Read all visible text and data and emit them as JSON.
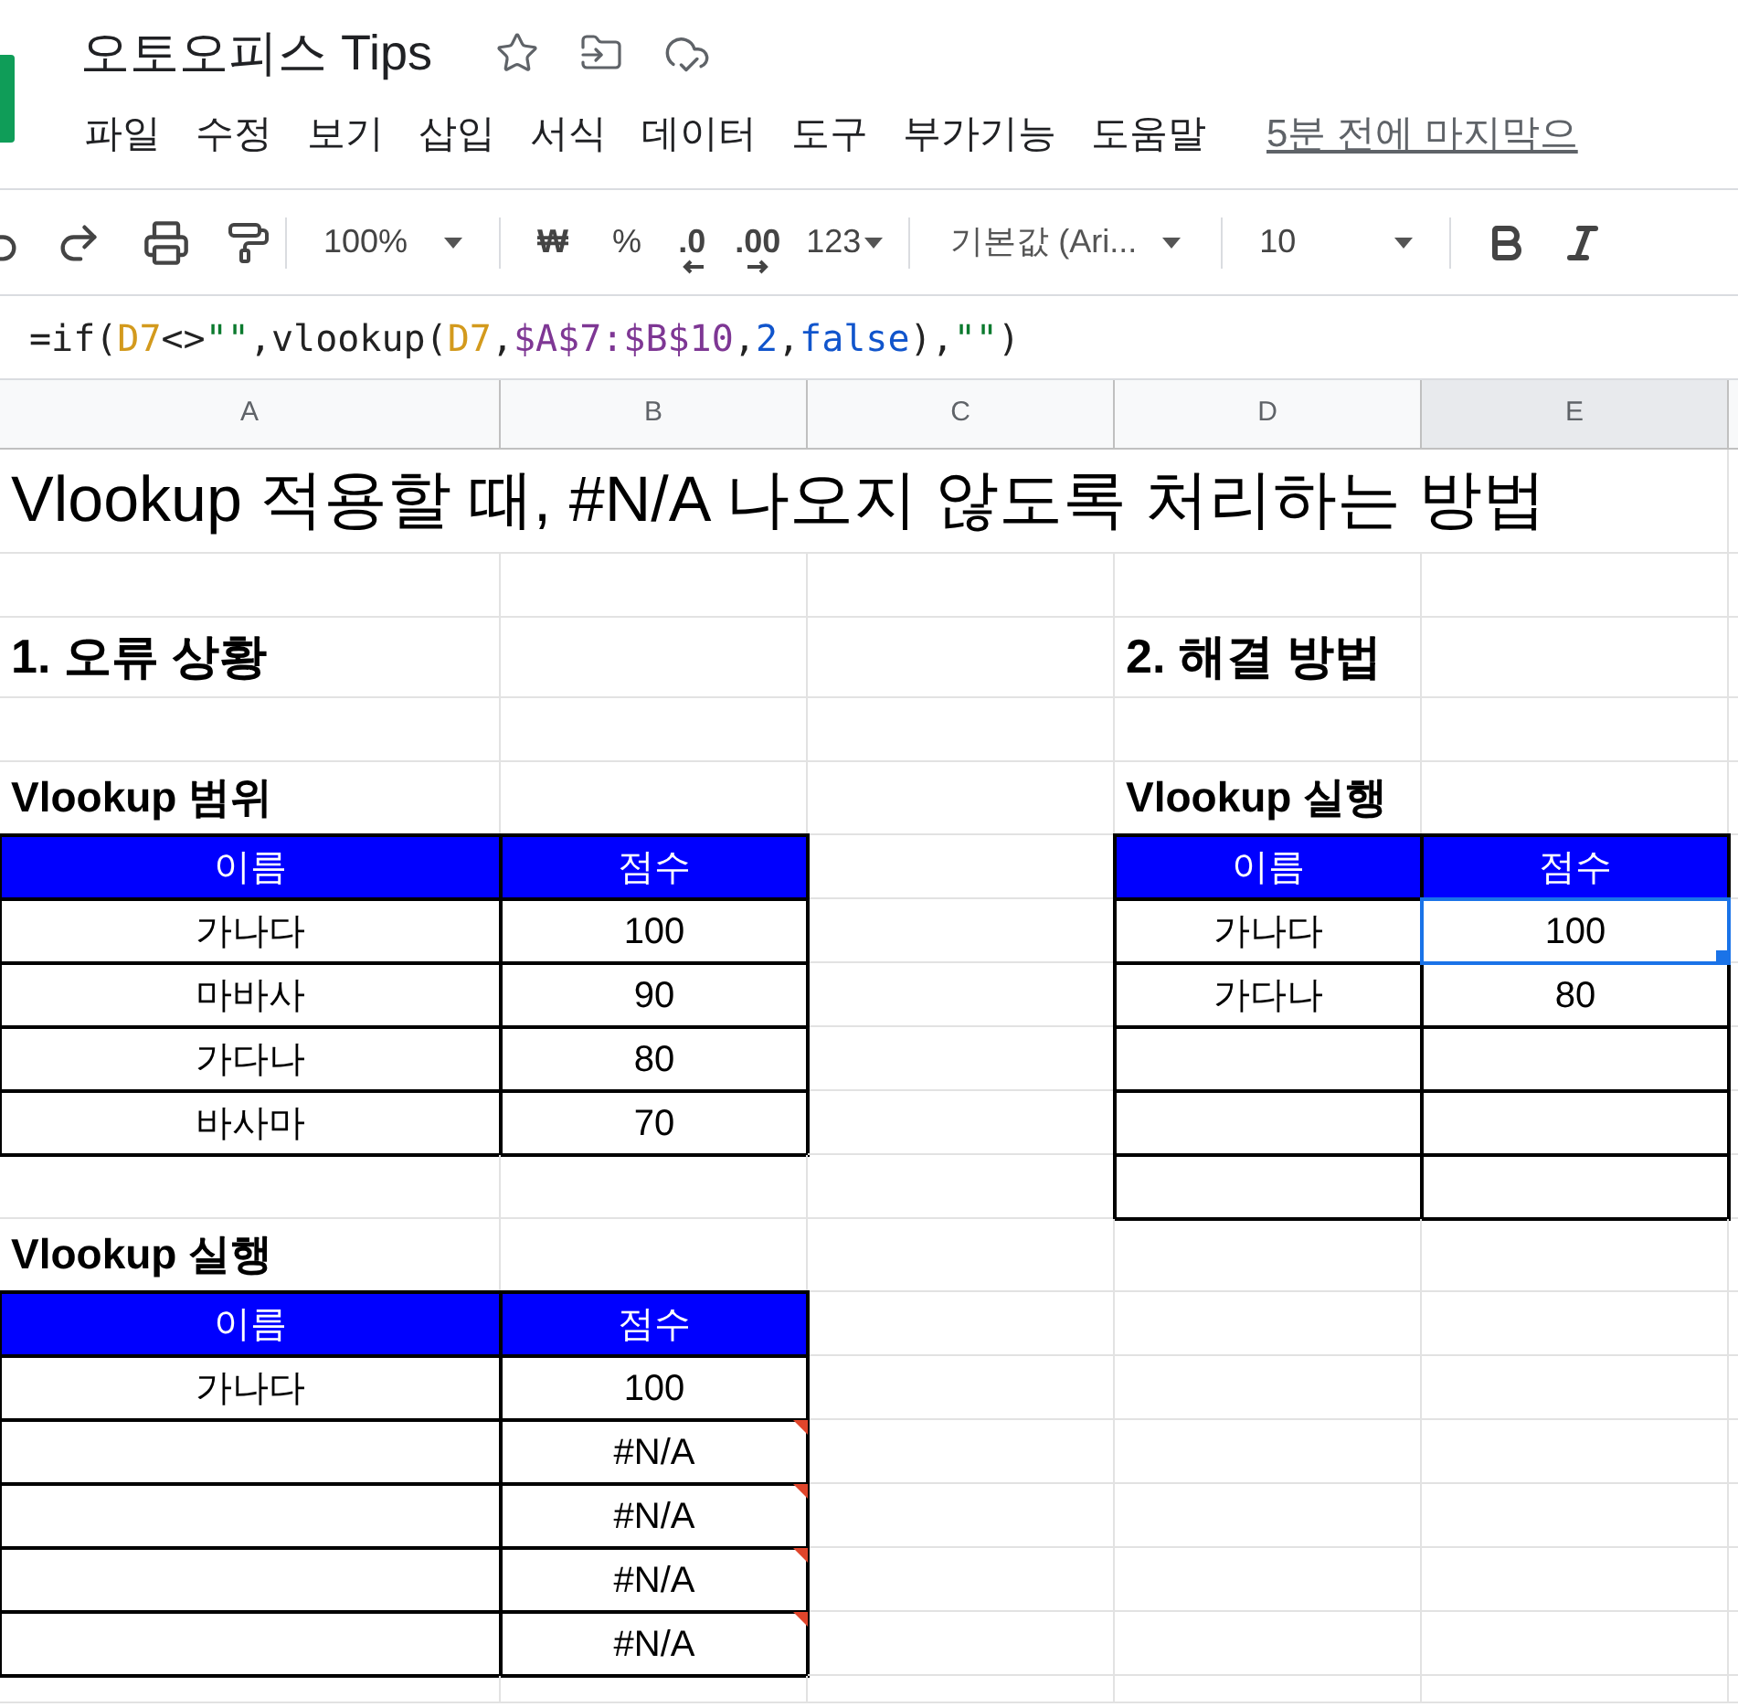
{
  "document": {
    "title": "오토오피스 Tips"
  },
  "menu": [
    "파일",
    "수정",
    "보기",
    "삽입",
    "서식",
    "데이터",
    "도구",
    "부가기능",
    "도움말"
  ],
  "last_edit": "5분 전에 마지막으",
  "toolbar": {
    "zoom": "100%",
    "currency": "₩",
    "percent": "%",
    "decrease_decimals": ".0",
    "increase_decimals": ".00",
    "number_format": "123",
    "font": "기본값 (Ari...",
    "font_size": "10"
  },
  "formula": [
    {
      "kind": "plain",
      "text": "=if("
    },
    {
      "kind": "ref",
      "text": "D7"
    },
    {
      "kind": "plain",
      "text": "<>"
    },
    {
      "kind": "string",
      "text": "\"\""
    },
    {
      "kind": "plain",
      "text": ",vlookup("
    },
    {
      "kind": "ref",
      "text": "D7"
    },
    {
      "kind": "plain",
      "text": ","
    },
    {
      "kind": "range",
      "text": "$A$7:$B$10"
    },
    {
      "kind": "plain",
      "text": ","
    },
    {
      "kind": "number",
      "text": "2"
    },
    {
      "kind": "plain",
      "text": ","
    },
    {
      "kind": "bool",
      "text": "false"
    },
    {
      "kind": "plain",
      "text": "),"
    },
    {
      "kind": "string",
      "text": "\"\""
    },
    {
      "kind": "plain",
      "text": ")"
    }
  ],
  "columns": [
    {
      "label": "A",
      "selected": false
    },
    {
      "label": "B",
      "selected": false
    },
    {
      "label": "C",
      "selected": false
    },
    {
      "label": "D",
      "selected": false
    },
    {
      "label": "E",
      "selected": true
    }
  ],
  "rows": [
    [
      {
        "kind": "title",
        "text": "Vlookup 적용할 때, #N/A 나오지 않도록 처리하는 방법",
        "selected": false
      }
    ],
    [
      {
        "kind": "blank",
        "selected": false
      },
      {
        "kind": "blank",
        "selected": false
      },
      {
        "kind": "blank",
        "selected": false
      },
      {
        "kind": "blank",
        "selected": false
      },
      {
        "kind": "blank",
        "selected": false
      }
    ],
    [
      {
        "kind": "heading",
        "text": "1. 오류 상황",
        "selected": false
      },
      {
        "kind": "blank",
        "selected": false
      },
      {
        "kind": "blank",
        "selected": false
      },
      {
        "kind": "heading",
        "text": "2. 해결 방법",
        "selected": false
      },
      {
        "kind": "blank",
        "selected": false
      }
    ],
    [
      {
        "kind": "blank",
        "selected": false
      },
      {
        "kind": "blank",
        "selected": false
      },
      {
        "kind": "blank",
        "selected": false
      },
      {
        "kind": "blank",
        "selected": false
      },
      {
        "kind": "blank",
        "selected": false
      }
    ],
    [
      {
        "kind": "subheading",
        "text": "Vlookup 범위",
        "selected": false
      },
      {
        "kind": "blank",
        "selected": false
      },
      {
        "kind": "blank",
        "selected": false
      },
      {
        "kind": "subheading",
        "text": "Vlookup 실행",
        "selected": false
      },
      {
        "kind": "blank",
        "selected": false
      }
    ],
    [
      {
        "kind": "header",
        "text": "이름",
        "selected": false
      },
      {
        "kind": "header",
        "text": "점수",
        "selected": false
      },
      {
        "kind": "blank",
        "selected": false
      },
      {
        "kind": "header",
        "text": "이름",
        "selected": false
      },
      {
        "kind": "header",
        "text": "점수",
        "selected": false
      }
    ],
    [
      {
        "kind": "table",
        "text": "가나다",
        "selected": false
      },
      {
        "kind": "table",
        "text": "100",
        "selected": false
      },
      {
        "kind": "blank",
        "selected": false
      },
      {
        "kind": "table",
        "text": "가나다",
        "selected": false
      },
      {
        "kind": "table",
        "text": "100",
        "selected": true
      }
    ],
    [
      {
        "kind": "table",
        "text": "마바사",
        "selected": false
      },
      {
        "kind": "table",
        "text": "90",
        "selected": false
      },
      {
        "kind": "blank",
        "selected": false
      },
      {
        "kind": "table",
        "text": "가다나",
        "selected": false
      },
      {
        "kind": "table",
        "text": "80",
        "selected": false
      }
    ],
    [
      {
        "kind": "table",
        "text": "가다나",
        "selected": false
      },
      {
        "kind": "table",
        "text": "80",
        "selected": false
      },
      {
        "kind": "blank",
        "selected": false
      },
      {
        "kind": "table",
        "selected": false
      },
      {
        "kind": "table",
        "selected": false
      }
    ],
    [
      {
        "kind": "table",
        "text": "바사마",
        "selected": false
      },
      {
        "kind": "table",
        "text": "70",
        "selected": false
      },
      {
        "kind": "blank",
        "selected": false
      },
      {
        "kind": "table",
        "selected": false
      },
      {
        "kind": "table",
        "selected": false
      }
    ],
    [
      {
        "kind": "blank",
        "selected": false
      },
      {
        "kind": "blank",
        "selected": false
      },
      {
        "kind": "blank",
        "selected": false
      },
      {
        "kind": "table",
        "selected": false
      },
      {
        "kind": "table",
        "selected": false
      }
    ],
    [
      {
        "kind": "subheading",
        "text": "Vlookup 실행",
        "selected": false
      },
      {
        "kind": "blank",
        "selected": false
      },
      {
        "kind": "blank",
        "selected": false
      },
      {
        "kind": "blank",
        "selected": false
      },
      {
        "kind": "blank",
        "selected": false
      }
    ],
    [
      {
        "kind": "header",
        "text": "이름",
        "selected": false
      },
      {
        "kind": "header",
        "text": "점수",
        "selected": false
      },
      {
        "kind": "blank",
        "selected": false
      },
      {
        "kind": "blank",
        "selected": false
      },
      {
        "kind": "blank",
        "selected": false
      }
    ],
    [
      {
        "kind": "table",
        "text": "가나다",
        "selected": false
      },
      {
        "kind": "table",
        "text": "100",
        "selected": false
      },
      {
        "kind": "blank",
        "selected": false
      },
      {
        "kind": "blank",
        "selected": false
      },
      {
        "kind": "blank",
        "selected": false
      }
    ],
    [
      {
        "kind": "table",
        "selected": false
      },
      {
        "kind": "error",
        "text": "#N/A",
        "selected": false
      },
      {
        "kind": "blank",
        "selected": false
      },
      {
        "kind": "blank",
        "selected": false
      },
      {
        "kind": "blank",
        "selected": false
      }
    ],
    [
      {
        "kind": "table",
        "selected": false
      },
      {
        "kind": "error",
        "text": "#N/A",
        "selected": false
      },
      {
        "kind": "blank",
        "selected": false
      },
      {
        "kind": "blank",
        "selected": false
      },
      {
        "kind": "blank",
        "selected": false
      }
    ],
    [
      {
        "kind": "table",
        "selected": false
      },
      {
        "kind": "error",
        "text": "#N/A",
        "selected": false
      },
      {
        "kind": "blank",
        "selected": false
      },
      {
        "kind": "blank",
        "selected": false
      },
      {
        "kind": "blank",
        "selected": false
      }
    ],
    [
      {
        "kind": "table",
        "selected": false
      },
      {
        "kind": "error",
        "text": "#N/A",
        "selected": false
      },
      {
        "kind": "blank",
        "selected": false
      },
      {
        "kind": "blank",
        "selected": false
      },
      {
        "kind": "blank",
        "selected": false
      }
    ],
    [
      {
        "kind": "blank",
        "selected": false
      },
      {
        "kind": "blank",
        "selected": false
      },
      {
        "kind": "blank",
        "selected": false
      },
      {
        "kind": "blank",
        "selected": false
      },
      {
        "kind": "blank",
        "selected": false
      }
    ]
  ]
}
